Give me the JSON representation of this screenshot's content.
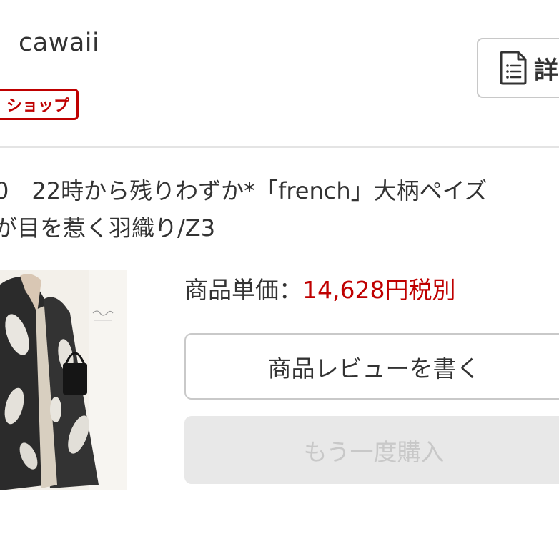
{
  "shop": {
    "name": "cawaii",
    "badge": "ショップ",
    "detail_button_label": "詳",
    "badge_color": "#bf0000"
  },
  "product": {
    "title_line1": "0　22時から残りわずか*「french」大柄ペイズ",
    "title_line2": "が目を惹く羽織り/Z3",
    "price_label": "商品単価：",
    "price_value": "14,628円税別",
    "price_color": "#bf0000",
    "image_alt": "product-photo"
  },
  "actions": {
    "review_label": "商品レビューを書く",
    "rebuy_label": "もう一度購入"
  },
  "icons": {
    "detail": "document-list-icon"
  }
}
